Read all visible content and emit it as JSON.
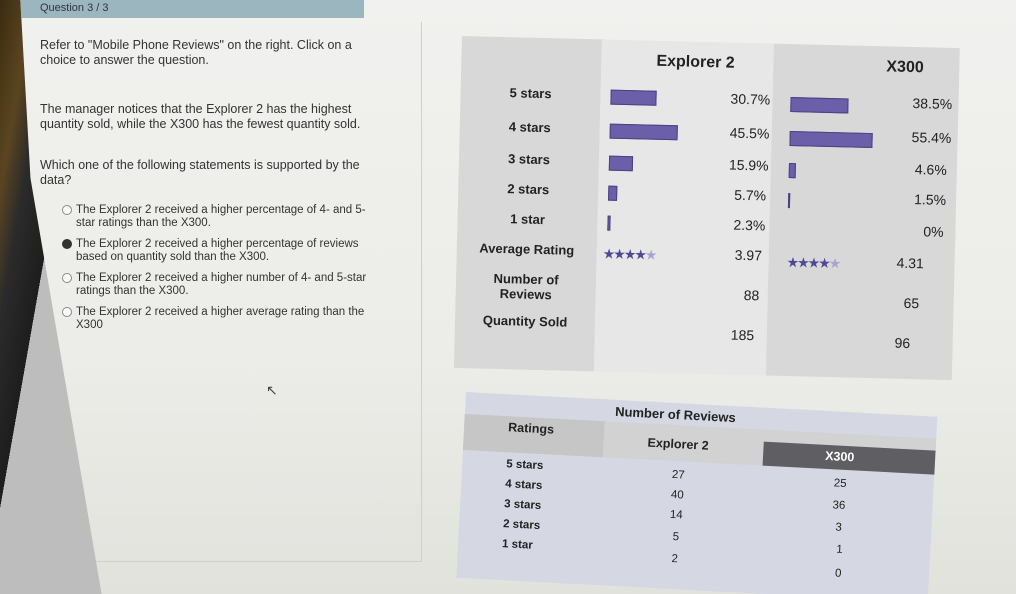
{
  "header": {
    "question_number": "Question 3 / 3"
  },
  "left": {
    "intro": "Refer to \"Mobile Phone Reviews\" on the right. Click on a choice to answer the question.",
    "notice": "The manager notices that the Explorer 2 has the highest quantity sold, while the X300 has the fewest quantity sold.",
    "question": "Which one of the following statements is supported by the data?",
    "choices": [
      "The Explorer 2 received a higher percentage of 4- and 5-star ratings than the X300.",
      "The Explorer 2 received a higher percentage of reviews based on quantity sold than the X300.",
      "The Explorer 2 received a higher number of 4- and 5-star ratings than the X300.",
      "The Explorer 2 received a higher average rating than the X300"
    ],
    "selected_index": 1
  },
  "table1": {
    "columns": [
      "Explorer 2",
      "X300"
    ],
    "rows": [
      {
        "label": "5 stars",
        "explorer": "30.7%",
        "x300": "38.5%",
        "explorer_frac": 0.307,
        "x300_frac": 0.385
      },
      {
        "label": "4 stars",
        "explorer": "45.5%",
        "x300": "55.4%",
        "explorer_frac": 0.455,
        "x300_frac": 0.554
      },
      {
        "label": "3 stars",
        "explorer": "15.9%",
        "x300": "4.6%",
        "explorer_frac": 0.159,
        "x300_frac": 0.046
      },
      {
        "label": "2 stars",
        "explorer": "5.7%",
        "x300": "1.5%",
        "explorer_frac": 0.057,
        "x300_frac": 0.015
      },
      {
        "label": "1 star",
        "explorer": "2.3%",
        "x300": "0%",
        "explorer_frac": 0.023,
        "x300_frac": 0.0
      }
    ],
    "average": {
      "label": "Average Rating",
      "explorer": "3.97",
      "x300": "4.31"
    },
    "reviews": {
      "label": "Number of Reviews",
      "explorer": "88",
      "x300": "65"
    },
    "sold": {
      "label": "Quantity Sold",
      "explorer": "185",
      "x300": "96"
    },
    "bar_color": "#6a5fa8"
  },
  "table2": {
    "title": "Number of Reviews",
    "headers": [
      "Ratings",
      "Explorer 2",
      "X300"
    ],
    "rows": [
      {
        "label": "5 stars",
        "explorer": "27",
        "x300": "25"
      },
      {
        "label": "4 stars",
        "explorer": "40",
        "x300": "36"
      },
      {
        "label": "3 stars",
        "explorer": "14",
        "x300": "3"
      },
      {
        "label": "2 stars",
        "explorer": "5",
        "x300": "1"
      },
      {
        "label": "1 star",
        "explorer": "2",
        "x300": "0"
      }
    ]
  }
}
